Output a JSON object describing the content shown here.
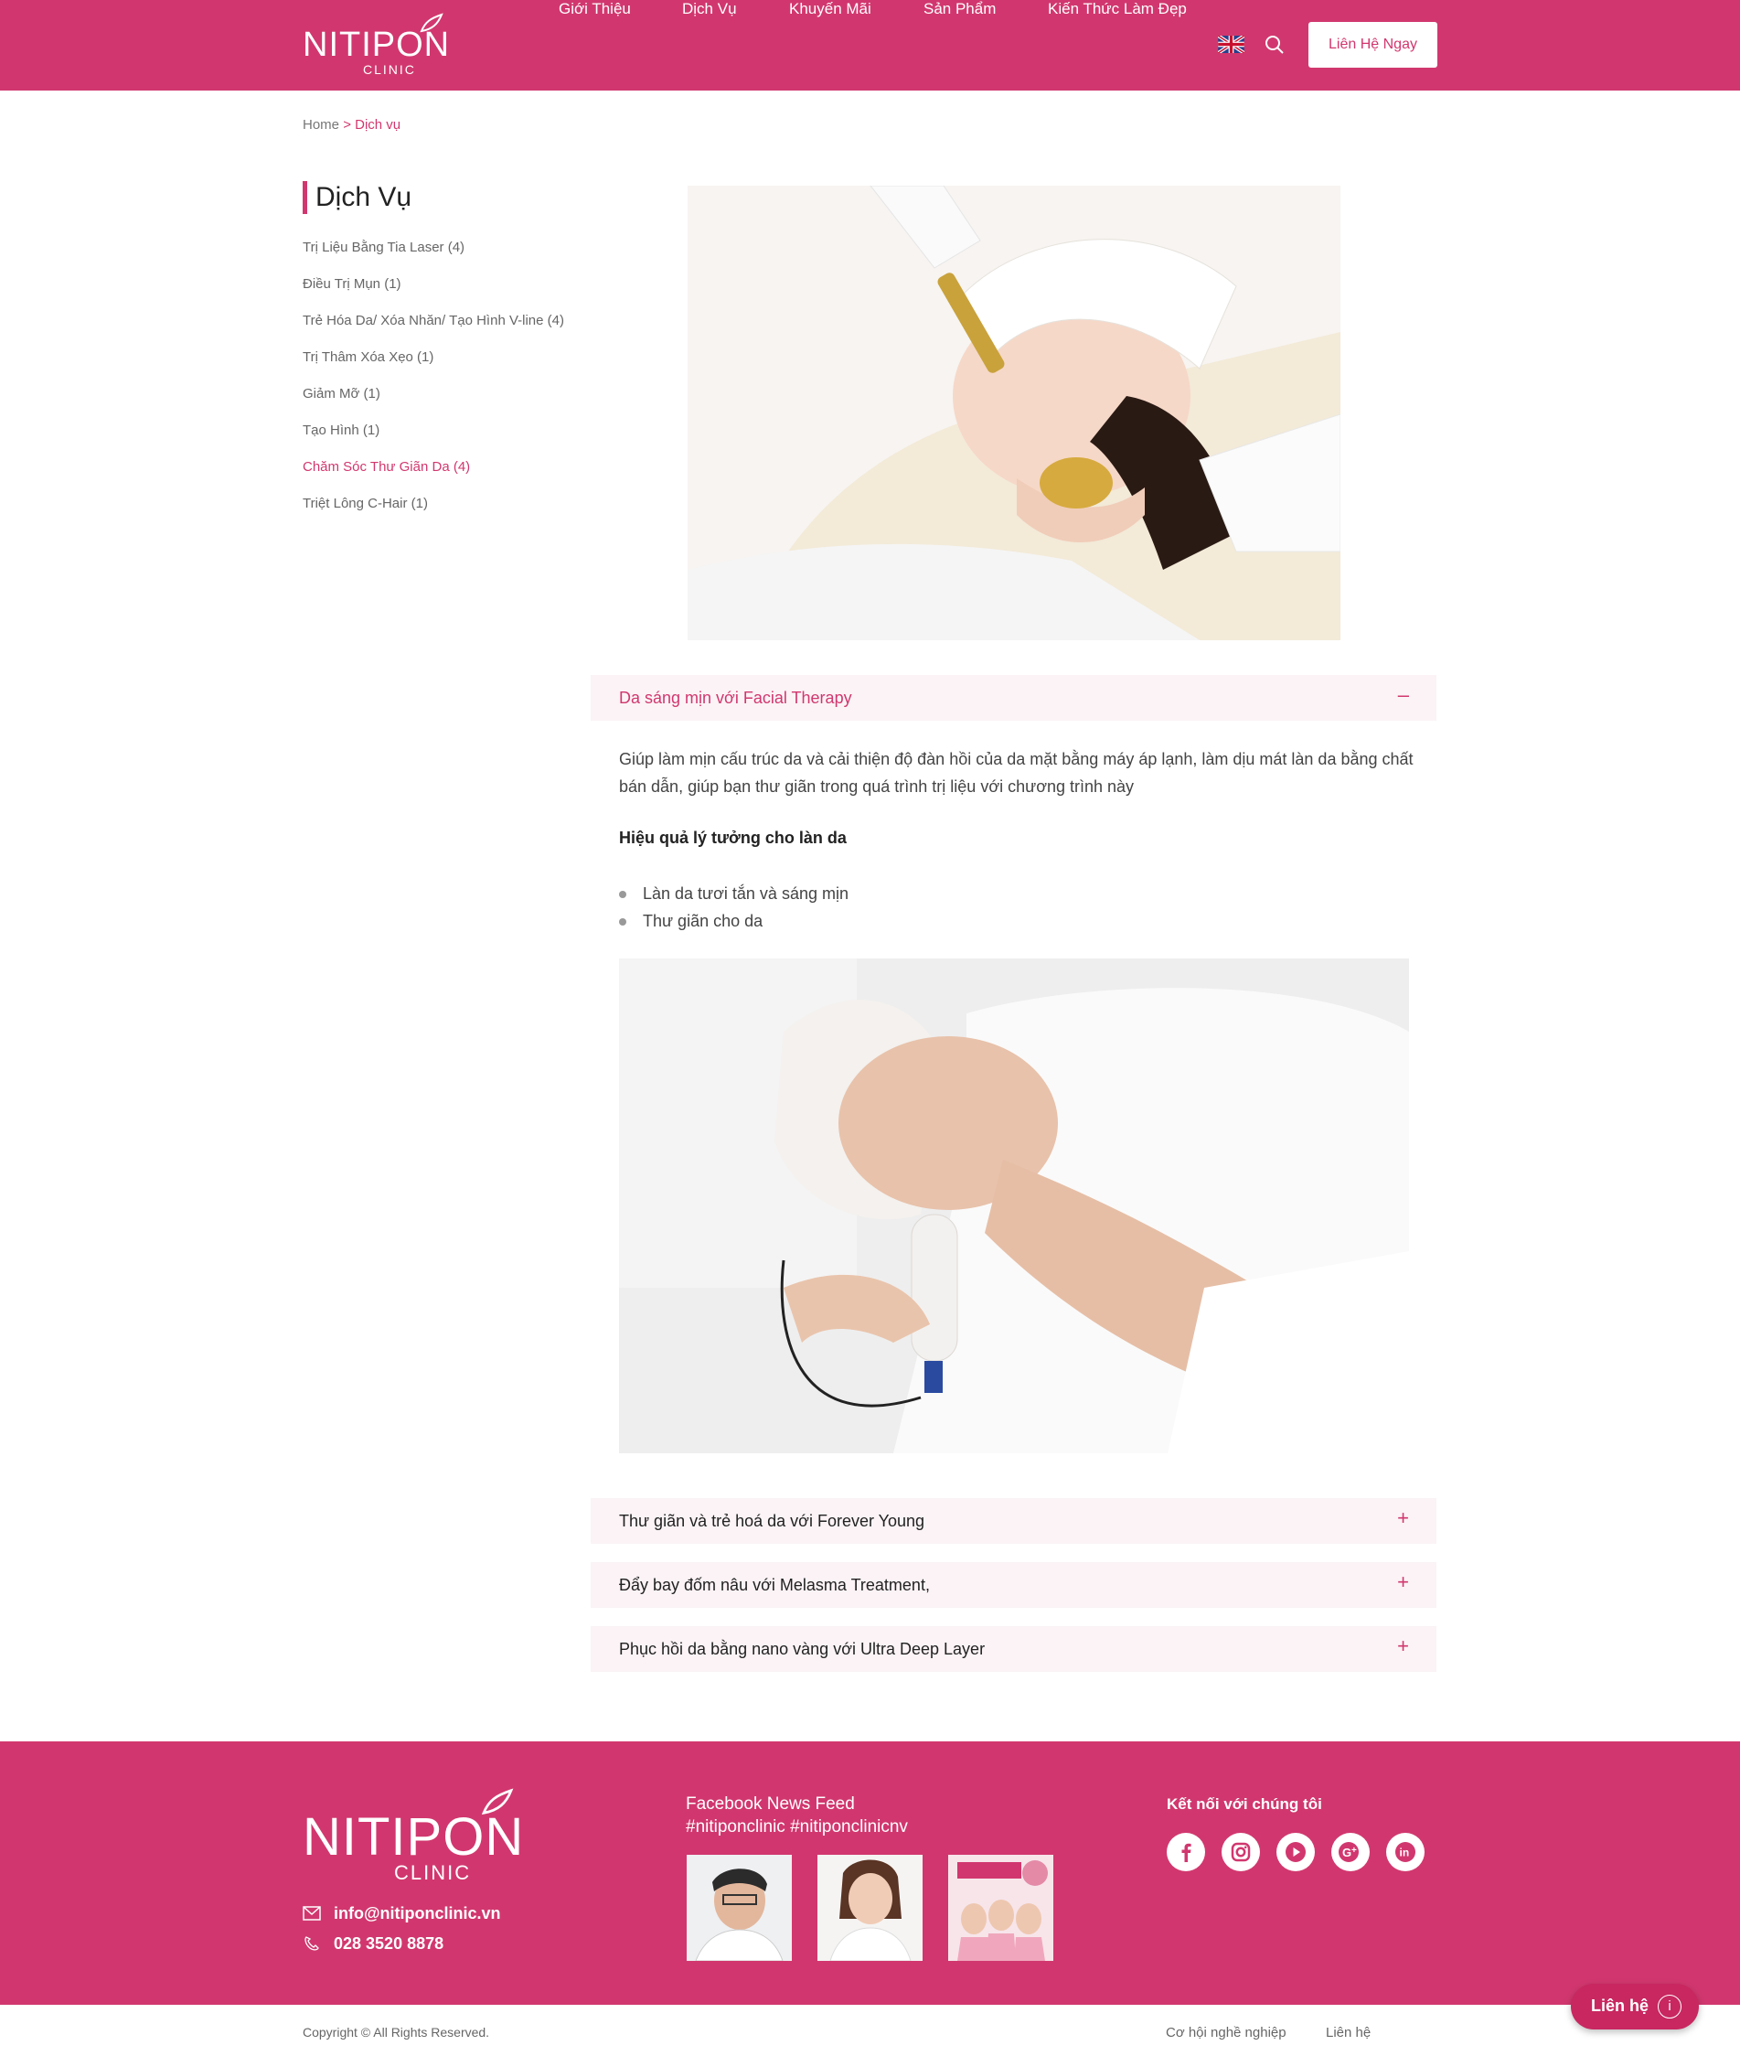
{
  "brand": {
    "name": "NITIPON",
    "sub": "CLINIC"
  },
  "nav": {
    "items": [
      "Giới Thiệu",
      "Dịch Vụ",
      "Khuyến Mãi",
      "Sản Phẩm",
      "Kiến Thức Làm Đẹp"
    ],
    "cta": "Liên Hệ Ngay"
  },
  "breadcrumb": {
    "home": "Home",
    "current": "> Dịch vụ"
  },
  "sidebar": {
    "title": "Dịch Vụ",
    "items": [
      "Trị Liệu Bằng Tia Laser (4)",
      "Điều Trị Mụn (1)",
      "Trẻ Hóa Da/ Xóa Nhăn/ Tạo Hình V-line (4)",
      "Trị Thâm Xóa Xẹo (1)",
      "Giảm Mỡ (1)",
      "Tạo Hình (1)",
      "Chăm Sóc Thư Giãn Da (4)",
      "Triệt Lông C-Hair (1)"
    ],
    "active_index": 6
  },
  "content": {
    "open_section": {
      "title": "Da sáng mịn với Facial Therapy",
      "sign": "–",
      "paragraph": "Giúp làm mịn cấu trúc da và cải thiện độ đàn hồi của da mặt bằng máy áp lạnh, làm dịu mát làn da bằng chất bán dẫn, giúp bạn thư giãn trong quá trình trị liệu với chương trình này",
      "subheading": "Hiệu quả lý tưởng cho làn da",
      "bullets": [
        "Làn da tươi tắn và sáng mịn",
        "Thư giãn cho da"
      ]
    },
    "collapsed_sections": [
      {
        "title": "Thư giãn và trẻ hoá da với Forever Young",
        "sign": "+"
      },
      {
        "title": "Đẩy bay đốm nâu với Melasma Treatment,",
        "sign": "+"
      },
      {
        "title": "Phục hồi da bằng nano vàng với Ultra Deep Layer",
        "sign": "+"
      }
    ]
  },
  "footer": {
    "email": "info@nitiponclinic.vn",
    "phone": "028 3520 8878",
    "feed_title_1": "Facebook News Feed",
    "feed_title_2": "#nitiponclinic #nitiponclinicnv",
    "connect_title": "Kết nối với chúng tôi",
    "social_icons": [
      "facebook-icon",
      "instagram-icon",
      "youtube-icon",
      "google-plus-icon",
      "linkedin-icon"
    ],
    "copyright": "Copyright © All Rights Reserved.",
    "links": [
      "Cơ hội nghề nghiệp",
      "Liên hệ"
    ]
  },
  "floating": {
    "label": "Liên hệ",
    "icon": "i"
  },
  "colors": {
    "brand": "#d1376e",
    "accordion_bg": "#fbf3f6"
  }
}
